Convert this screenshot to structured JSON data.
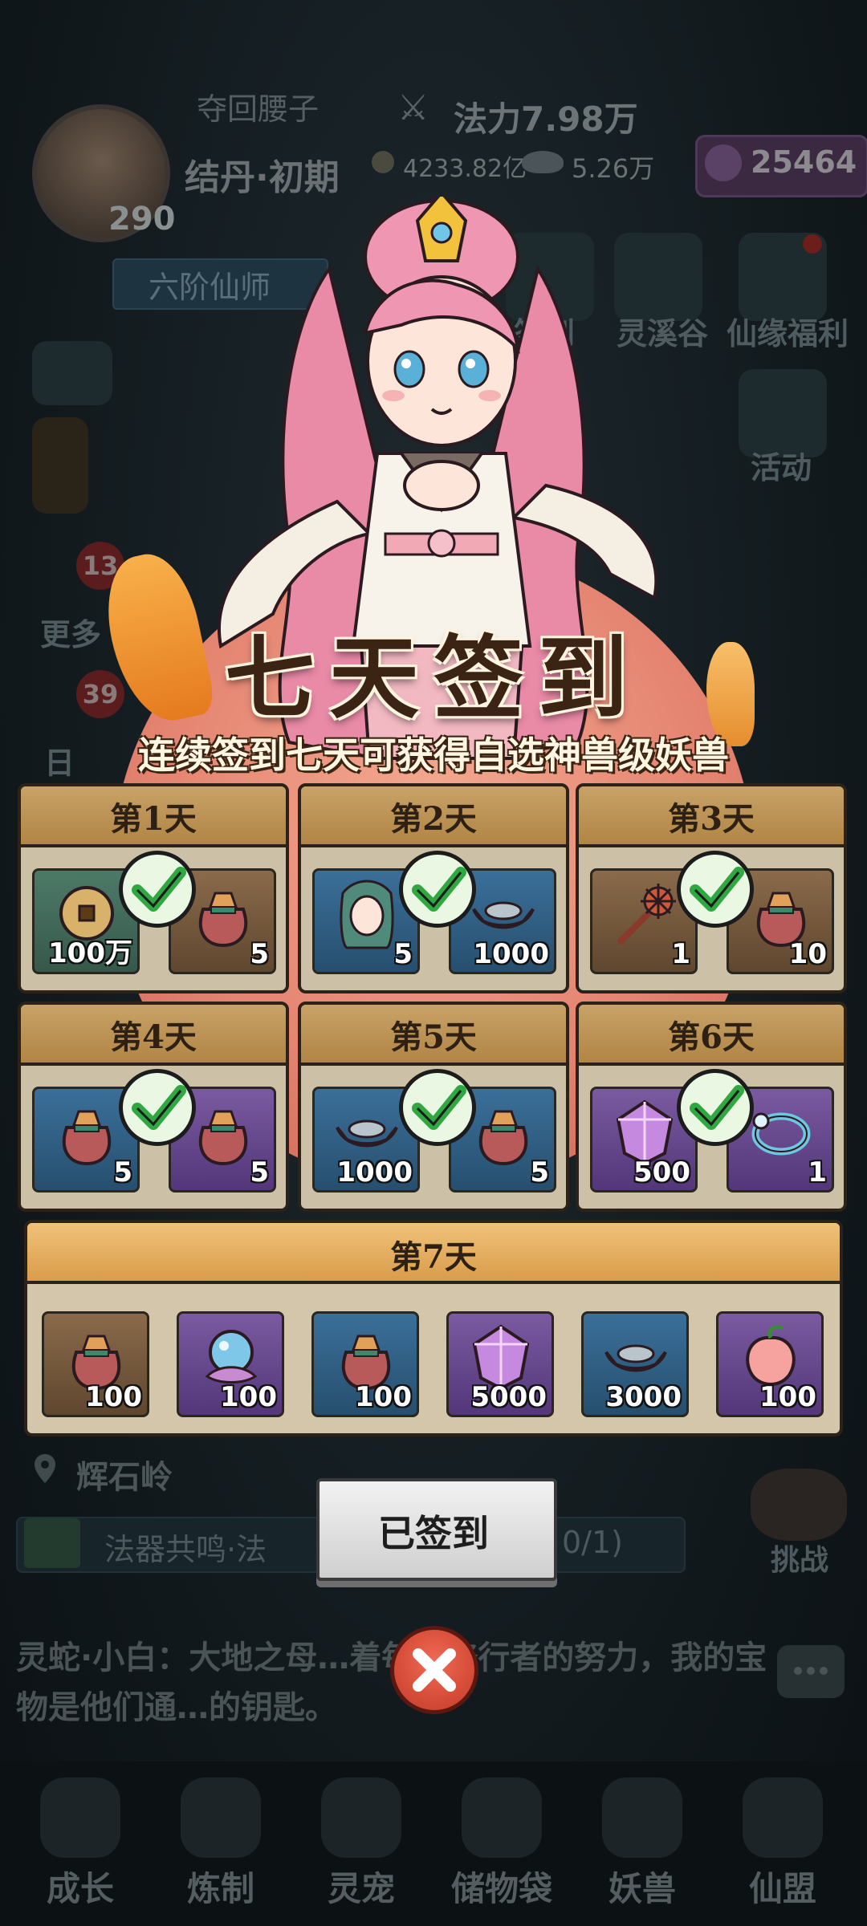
{
  "hud": {
    "player_name": "夺回腰子",
    "realm": "结丹·初期",
    "level": "290",
    "power_label": "法力7.98万",
    "copper": "4233.82亿",
    "silver": "5.26万",
    "jade": "25464",
    "rank_title": "六阶仙师"
  },
  "side_buttons": {
    "right": [
      "签到",
      "灵溪谷",
      "仙缘福利",
      "活动"
    ],
    "left_more": "更多",
    "left_day": "日",
    "badge_more": "13",
    "badge_day": "39"
  },
  "scene": {
    "location": "辉石岭",
    "quest": "法器共鸣·法",
    "quest_progress": "0/1)",
    "challenge": "挑战",
    "dialog": "灵蛇·小白：大地之母…着每个修行者的努力，我的宝物是他们通…的钥匙。"
  },
  "modal": {
    "title": "七天签到",
    "subtitle": "连续签到七天可获得自选神兽级妖兽",
    "days": [
      {
        "label": "第1天",
        "claimed": true,
        "items": [
          {
            "icon": "copper-coin-icon",
            "qty": "100万",
            "color": "green"
          },
          {
            "icon": "treasure-bag-icon",
            "qty": "5",
            "color": "brown"
          }
        ]
      },
      {
        "label": "第2天",
        "claimed": true,
        "items": [
          {
            "icon": "companion-portrait-icon",
            "qty": "5",
            "color": "blue"
          },
          {
            "icon": "silver-ingot-icon",
            "qty": "1000",
            "color": "blue"
          }
        ]
      },
      {
        "label": "第3天",
        "claimed": true,
        "items": [
          {
            "icon": "spiked-mace-icon",
            "qty": "1",
            "color": "brown"
          },
          {
            "icon": "treasure-bag-icon",
            "qty": "10",
            "color": "brown"
          }
        ]
      },
      {
        "label": "第4天",
        "claimed": true,
        "items": [
          {
            "icon": "treasure-bag-icon",
            "qty": "5",
            "color": "blue"
          },
          {
            "icon": "treasure-bag-icon",
            "qty": "5",
            "color": "purple"
          }
        ]
      },
      {
        "label": "第5天",
        "claimed": true,
        "items": [
          {
            "icon": "silver-ingot-icon",
            "qty": "1000",
            "color": "blue"
          },
          {
            "icon": "treasure-bag-icon",
            "qty": "5",
            "color": "blue"
          }
        ]
      },
      {
        "label": "第6天",
        "claimed": true,
        "items": [
          {
            "icon": "purple-gem-icon",
            "qty": "500",
            "color": "purple"
          },
          {
            "icon": "bracelet-icon",
            "qty": "1",
            "color": "purple"
          }
        ]
      }
    ],
    "day7": {
      "label": "第7天",
      "items": [
        {
          "icon": "treasure-bag-icon",
          "qty": "100",
          "color": "brown"
        },
        {
          "icon": "spirit-orb-icon",
          "qty": "100",
          "color": "purple"
        },
        {
          "icon": "treasure-bag-icon",
          "qty": "100",
          "color": "blue"
        },
        {
          "icon": "purple-gem-icon",
          "qty": "5000",
          "color": "purple"
        },
        {
          "icon": "silver-ingot-icon",
          "qty": "3000",
          "color": "blue"
        },
        {
          "icon": "peach-icon",
          "qty": "100",
          "color": "purple"
        }
      ]
    },
    "signed_button": "已签到"
  },
  "bottom_nav": [
    "成长",
    "炼制",
    "灵宠",
    "储物袋",
    "妖兽",
    "仙盟"
  ],
  "colors": {
    "header_gold": "#c8a267",
    "day7_header": "#f0c27a",
    "check_green": "#3fb24a",
    "close_red": "#d9483a"
  }
}
